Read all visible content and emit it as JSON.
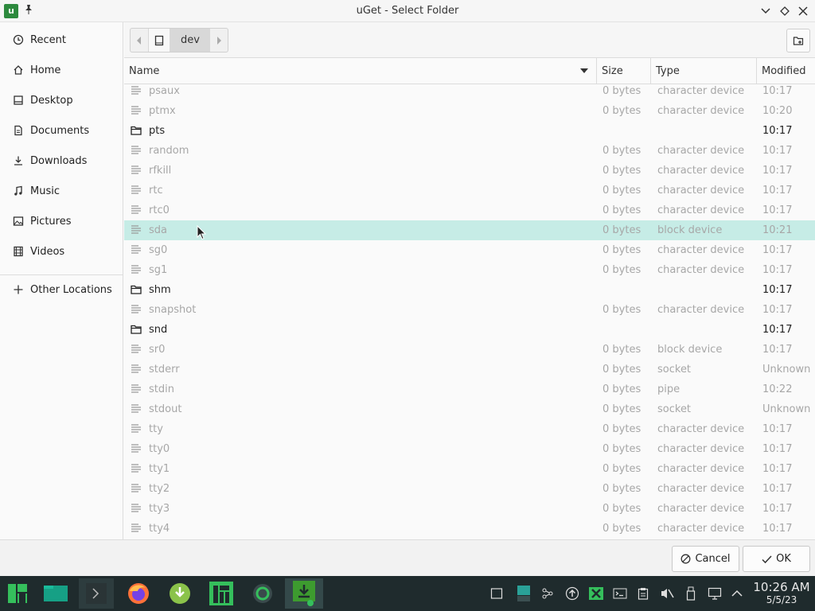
{
  "window": {
    "title": "uGet - Select Folder",
    "app_icon_letter": "u"
  },
  "sidebar": {
    "items": [
      {
        "label": "Recent",
        "icon": "clock-icon"
      },
      {
        "label": "Home",
        "icon": "home-icon"
      },
      {
        "label": "Desktop",
        "icon": "desktop-icon"
      },
      {
        "label": "Documents",
        "icon": "document-icon"
      },
      {
        "label": "Downloads",
        "icon": "download-icon"
      },
      {
        "label": "Music",
        "icon": "music-icon"
      },
      {
        "label": "Pictures",
        "icon": "picture-icon"
      },
      {
        "label": "Videos",
        "icon": "video-icon"
      }
    ],
    "other_locations": {
      "label": "Other Locations",
      "icon": "plus-icon"
    }
  },
  "pathbar": {
    "current": "dev"
  },
  "columns": {
    "name": "Name",
    "size": "Size",
    "type": "Type",
    "modified": "Modified"
  },
  "files": [
    {
      "name": "psaux",
      "size": "0 bytes",
      "type": "character device",
      "modified": "10:17",
      "kind": "file"
    },
    {
      "name": "ptmx",
      "size": "0 bytes",
      "type": "character device",
      "modified": "10:20",
      "kind": "file"
    },
    {
      "name": "pts",
      "size": "",
      "type": "",
      "modified": "10:17",
      "kind": "folder"
    },
    {
      "name": "random",
      "size": "0 bytes",
      "type": "character device",
      "modified": "10:17",
      "kind": "file"
    },
    {
      "name": "rfkill",
      "size": "0 bytes",
      "type": "character device",
      "modified": "10:17",
      "kind": "file"
    },
    {
      "name": "rtc",
      "size": "0 bytes",
      "type": "character device",
      "modified": "10:17",
      "kind": "file"
    },
    {
      "name": "rtc0",
      "size": "0 bytes",
      "type": "character device",
      "modified": "10:17",
      "kind": "file"
    },
    {
      "name": "sda",
      "size": "0 bytes",
      "type": "block device",
      "modified": "10:21",
      "kind": "file",
      "selected": true
    },
    {
      "name": "sg0",
      "size": "0 bytes",
      "type": "character device",
      "modified": "10:17",
      "kind": "file"
    },
    {
      "name": "sg1",
      "size": "0 bytes",
      "type": "character device",
      "modified": "10:17",
      "kind": "file"
    },
    {
      "name": "shm",
      "size": "",
      "type": "",
      "modified": "10:17",
      "kind": "folder"
    },
    {
      "name": "snapshot",
      "size": "0 bytes",
      "type": "character device",
      "modified": "10:17",
      "kind": "file"
    },
    {
      "name": "snd",
      "size": "",
      "type": "",
      "modified": "10:17",
      "kind": "folder"
    },
    {
      "name": "sr0",
      "size": "0 bytes",
      "type": "block device",
      "modified": "10:17",
      "kind": "file"
    },
    {
      "name": "stderr",
      "size": "0 bytes",
      "type": "socket",
      "modified": "Unknown",
      "kind": "file"
    },
    {
      "name": "stdin",
      "size": "0 bytes",
      "type": "pipe",
      "modified": "10:22",
      "kind": "file"
    },
    {
      "name": "stdout",
      "size": "0 bytes",
      "type": "socket",
      "modified": "Unknown",
      "kind": "file"
    },
    {
      "name": "tty",
      "size": "0 bytes",
      "type": "character device",
      "modified": "10:17",
      "kind": "file"
    },
    {
      "name": "tty0",
      "size": "0 bytes",
      "type": "character device",
      "modified": "10:17",
      "kind": "file"
    },
    {
      "name": "tty1",
      "size": "0 bytes",
      "type": "character device",
      "modified": "10:17",
      "kind": "file"
    },
    {
      "name": "tty2",
      "size": "0 bytes",
      "type": "character device",
      "modified": "10:17",
      "kind": "file"
    },
    {
      "name": "tty3",
      "size": "0 bytes",
      "type": "character device",
      "modified": "10:17",
      "kind": "file"
    },
    {
      "name": "tty4",
      "size": "0 bytes",
      "type": "character device",
      "modified": "10:17",
      "kind": "file"
    }
  ],
  "actions": {
    "cancel": "Cancel",
    "ok": "OK"
  },
  "taskbar": {
    "apps": [
      "manjaro-menu-icon",
      "files-icon",
      "terminal-icon",
      "firefox-icon",
      "uget-download-icon",
      "manjaro-settings-icon",
      "obs-icon",
      "uget-icon"
    ],
    "tray": [
      "window-icon",
      "workspace-icon",
      "network-icon",
      "update-icon",
      "x-app-icon",
      "console-icon",
      "clipboard-icon",
      "volume-muted-icon",
      "usb-icon",
      "display-icon",
      "chevron-up-icon"
    ],
    "time": "10:26 AM",
    "date": "5/5/23"
  },
  "colors": {
    "selected_row": "#c6ece6",
    "taskbar_bg": "#1f2b2d",
    "accent_green": "#2d8a3e"
  }
}
